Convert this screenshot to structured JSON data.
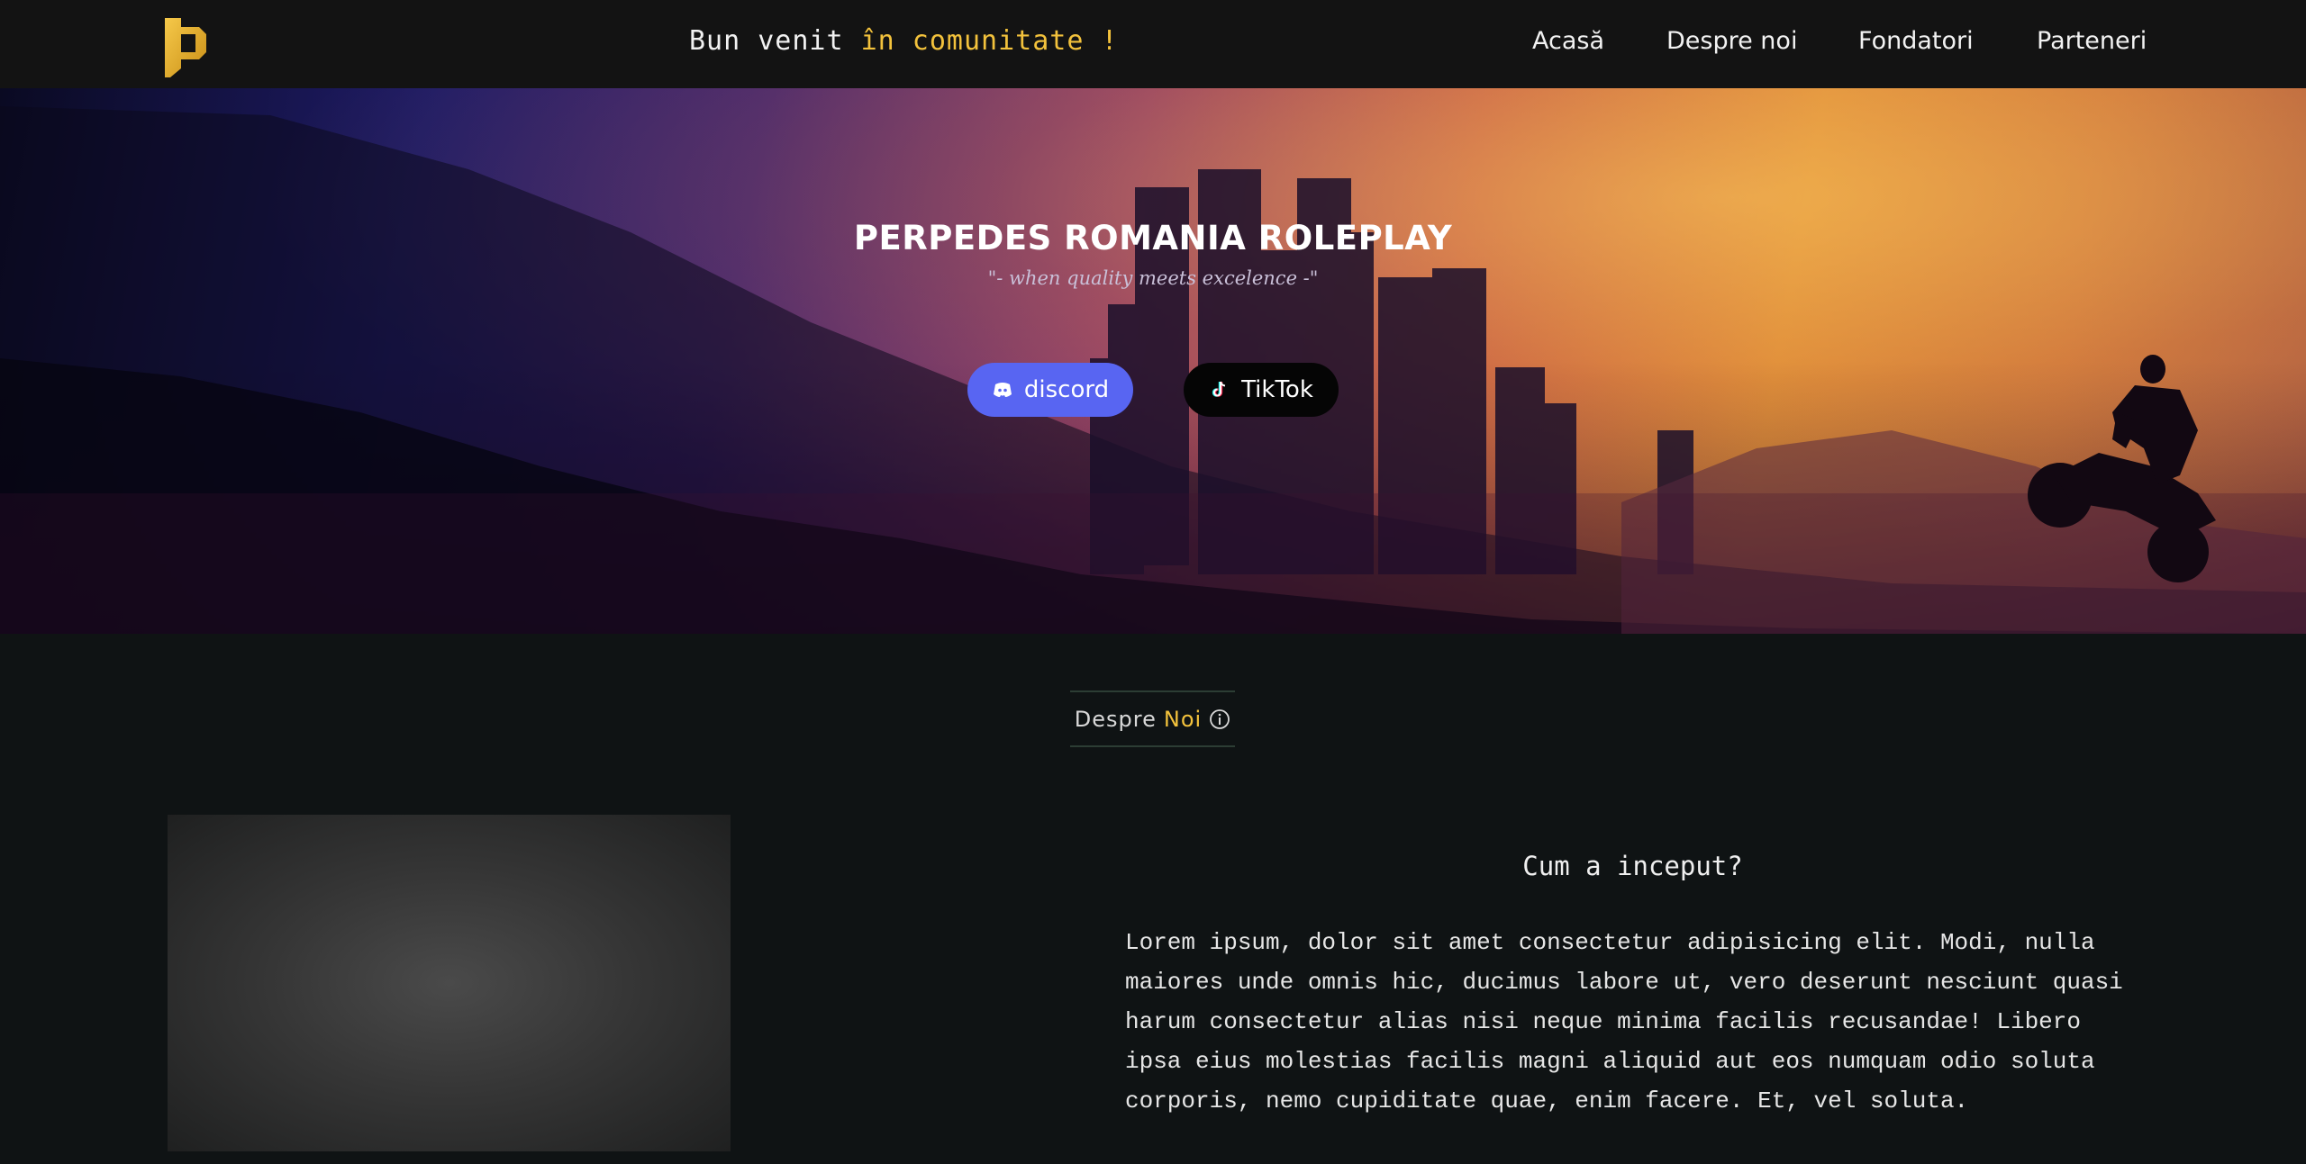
{
  "navbar": {
    "logo_icon": "p-logo-icon",
    "welcome_prefix": "Bun venit ",
    "welcome_accent": "în comunitate !",
    "links": [
      "Acasă",
      "Despre noi",
      "Fondatori",
      "Parteneri"
    ]
  },
  "hero": {
    "title": "PERPEDES ROMANIA ROLEPLAY",
    "subtitle": "\"- when quality meets excelence -\"",
    "discord_label": "discord",
    "tiktok_label": "TikTok"
  },
  "about": {
    "heading_prefix": "Despre ",
    "heading_accent": "Noi",
    "title": "Cum a inceput?",
    "text": "Lorem ipsum, dolor sit amet consectetur adipisicing elit. Modi, nulla maiores unde omnis hic, ducimus labore ut, vero deserunt nesciunt quasi harum consectetur alias nisi neque minima facilis recusandae! Libero ipsa eius molestias facilis magni aliquid aut eos numquam odio soluta corporis, nemo cupiditate quae, enim facere. Et, vel soluta."
  },
  "colors": {
    "accent": "#f3c23c",
    "discord": "#5865f2",
    "navbar_bg": "#131313",
    "page_bg": "#0f1314"
  }
}
